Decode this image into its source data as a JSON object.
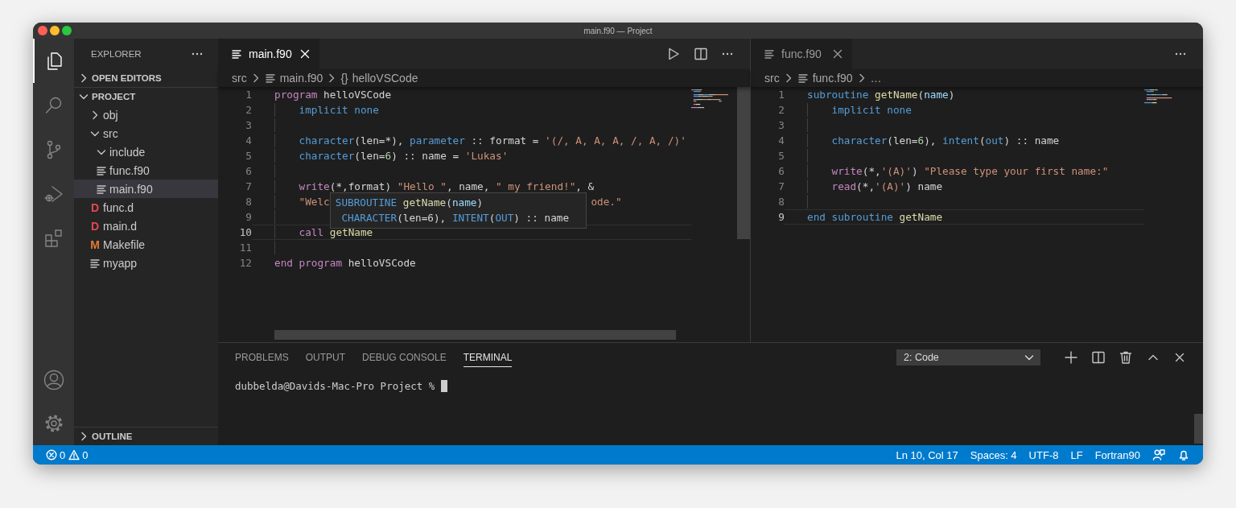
{
  "window": {
    "title": "main.f90 — Project"
  },
  "activity_bar": [
    {
      "kind": "files",
      "selected": true
    },
    {
      "kind": "search",
      "selected": false
    },
    {
      "kind": "source-control",
      "selected": false
    },
    {
      "kind": "run-debug",
      "selected": false
    },
    {
      "kind": "extensions",
      "selected": false
    }
  ],
  "activity_bar_bottom": [
    {
      "kind": "account"
    },
    {
      "kind": "settings"
    }
  ],
  "sidebar": {
    "title": "EXPLORER",
    "sections": [
      {
        "title": "OPEN EDITORS",
        "expanded": false
      },
      {
        "title": "PROJECT",
        "expanded": true,
        "items": [
          {
            "label": "obj",
            "kind": "folder",
            "expanded": false,
            "selected": false
          },
          {
            "label": "src",
            "kind": "folder",
            "expanded": true,
            "selected": false,
            "children": [
              {
                "label": "include",
                "kind": "folder",
                "expanded": true,
                "selected": false
              },
              {
                "label": "func.f90",
                "kind": "file",
                "selected": false
              },
              {
                "label": "main.f90",
                "kind": "file",
                "selected": true
              }
            ]
          },
          {
            "label": "func.d",
            "kind": "letter-file",
            "letter": "D",
            "color": "#e0484e",
            "selected": false
          },
          {
            "label": "main.d",
            "kind": "letter-file",
            "letter": "D",
            "color": "#e0484e",
            "selected": false
          },
          {
            "label": "Makefile",
            "kind": "letter-file",
            "letter": "M",
            "color": "#e37933",
            "selected": false
          },
          {
            "label": "myapp",
            "kind": "file",
            "selected": false
          }
        ]
      },
      {
        "title": "OUTLINE",
        "expanded": false
      }
    ]
  },
  "editor_groups": [
    {
      "focused": true,
      "tabs": [
        {
          "label": "main.f90",
          "selected": true
        }
      ],
      "actions": [
        {
          "kind": "run"
        },
        {
          "kind": "split"
        },
        {
          "kind": "more"
        }
      ],
      "breadcrumb": [
        {
          "kind": "text",
          "text": "src"
        },
        {
          "kind": "file",
          "text": "main.f90"
        },
        {
          "kind": "symbol",
          "icon": "{}",
          "text": "helloVSCode"
        }
      ],
      "lines": [
        {
          "number": "1",
          "current": false,
          "indented": false,
          "tokens": [
            {
              "kind": "keyword",
              "text": "program"
            },
            {
              "kind": "plain",
              "text": " helloVSCode"
            }
          ]
        },
        {
          "number": "2",
          "current": false,
          "indented": true,
          "tokens": [
            {
              "kind": "type",
              "text": "implicit none"
            }
          ]
        },
        {
          "number": "3",
          "current": false,
          "indented": true
        },
        {
          "number": "4",
          "current": false,
          "indented": true,
          "tokens": [
            {
              "kind": "type",
              "text": "character"
            },
            {
              "kind": "plain",
              "text": "(len=*), "
            },
            {
              "kind": "type",
              "text": "parameter"
            },
            {
              "kind": "plain",
              "text": " :: format = "
            },
            {
              "kind": "string",
              "text": "'(/, A, A, A, /, A, /)'"
            }
          ]
        },
        {
          "number": "5",
          "current": false,
          "indented": true,
          "tokens": [
            {
              "kind": "type",
              "text": "character"
            },
            {
              "kind": "plain",
              "text": "(len="
            },
            {
              "kind": "number",
              "text": "6"
            },
            {
              "kind": "plain",
              "text": ") :: name = "
            },
            {
              "kind": "string",
              "text": "'Lukas'"
            }
          ]
        },
        {
          "number": "6",
          "current": false,
          "indented": true
        },
        {
          "number": "7",
          "current": false,
          "indented": true,
          "tokens": [
            {
              "kind": "keyword",
              "text": "write"
            },
            {
              "kind": "plain",
              "text": "(*,format) "
            },
            {
              "kind": "string",
              "text": "\"Hello \""
            },
            {
              "kind": "plain",
              "text": ", name, "
            },
            {
              "kind": "string",
              "text": "\" my friend!\""
            },
            {
              "kind": "plain",
              "text": ", &"
            }
          ]
        },
        {
          "number": "8",
          "current": false,
          "indented": true,
          "tokens": [
            {
              "kind": "string",
              "text": "\"Welc"
            },
            {
              "kind": "hidden"
            },
            {
              "kind": "string",
              "text": "ode.\""
            }
          ]
        },
        {
          "number": "9",
          "current": false,
          "indented": true
        },
        {
          "number": "10",
          "current": true,
          "indented": true,
          "tokens": [
            {
              "kind": "keyword",
              "text": "call"
            },
            {
              "kind": "function",
              "text": " getName"
            }
          ]
        },
        {
          "number": "11",
          "current": false,
          "indented": true
        },
        {
          "number": "12",
          "current": false,
          "indented": false,
          "tokens": [
            {
              "kind": "keyword",
              "text": "end program"
            },
            {
              "kind": "plain",
              "text": " helloVSCode"
            }
          ]
        }
      ],
      "hover": {
        "lines": [
          [
            {
              "kind": "type",
              "text": "SUBROUTINE"
            },
            {
              "kind": "function",
              "text": " getName"
            },
            {
              "kind": "plain",
              "text": "("
            },
            {
              "kind": "variable",
              "text": "name"
            },
            {
              "kind": "plain",
              "text": ")"
            }
          ],
          [
            {
              "kind": "type",
              "text": " CHARACTER"
            },
            {
              "kind": "plain",
              "text": "(len=6), "
            },
            {
              "kind": "type",
              "text": "INTENT"
            },
            {
              "kind": "plain",
              "text": "("
            },
            {
              "kind": "type",
              "text": "OUT"
            },
            {
              "kind": "plain",
              "text": ") :: name"
            }
          ]
        ]
      }
    },
    {
      "focused": false,
      "tabs": [
        {
          "label": "func.f90",
          "selected": true
        }
      ],
      "actions": [
        {
          "kind": "more"
        }
      ],
      "breadcrumb": [
        {
          "kind": "text",
          "text": "src"
        },
        {
          "kind": "file",
          "text": "func.f90"
        },
        {
          "kind": "text",
          "text": "…"
        }
      ],
      "lines": [
        {
          "number": "1",
          "current": false,
          "indented": false,
          "tokens": [
            {
              "kind": "type",
              "text": "subroutine"
            },
            {
              "kind": "function",
              "text": " getName"
            },
            {
              "kind": "plain",
              "text": "("
            },
            {
              "kind": "variable",
              "text": "name"
            },
            {
              "kind": "plain",
              "text": ")"
            }
          ]
        },
        {
          "number": "2",
          "current": false,
          "indented": true,
          "tokens": [
            {
              "kind": "type",
              "text": "implicit none"
            }
          ]
        },
        {
          "number": "3",
          "current": false,
          "indented": true
        },
        {
          "number": "4",
          "current": false,
          "indented": true,
          "tokens": [
            {
              "kind": "type",
              "text": "character"
            },
            {
              "kind": "plain",
              "text": "(len="
            },
            {
              "kind": "number",
              "text": "6"
            },
            {
              "kind": "plain",
              "text": "), "
            },
            {
              "kind": "type",
              "text": "intent"
            },
            {
              "kind": "plain",
              "text": "("
            },
            {
              "kind": "type",
              "text": "out"
            },
            {
              "kind": "plain",
              "text": ") :: name"
            }
          ]
        },
        {
          "number": "5",
          "current": false,
          "indented": true
        },
        {
          "number": "6",
          "current": false,
          "indented": true,
          "tokens": [
            {
              "kind": "keyword",
              "text": "write"
            },
            {
              "kind": "plain",
              "text": "(*,"
            },
            {
              "kind": "string",
              "text": "'(A)'"
            },
            {
              "kind": "plain",
              "text": ") "
            },
            {
              "kind": "string",
              "text": "\"Please type your first name:\""
            }
          ]
        },
        {
          "number": "7",
          "current": false,
          "indented": true,
          "tokens": [
            {
              "kind": "keyword",
              "text": "read"
            },
            {
              "kind": "plain",
              "text": "(*,"
            },
            {
              "kind": "string",
              "text": "'(A)'"
            },
            {
              "kind": "plain",
              "text": ") name"
            }
          ]
        },
        {
          "number": "8",
          "current": false,
          "indented": true
        },
        {
          "number": "9",
          "current": true,
          "indented": false,
          "tokens": [
            {
              "kind": "type",
              "text": "end subroutine"
            },
            {
              "kind": "function",
              "text": " getName"
            }
          ]
        }
      ]
    }
  ],
  "panel": {
    "tabs": [
      {
        "label": "PROBLEMS",
        "selected": false
      },
      {
        "label": "OUTPUT",
        "selected": false
      },
      {
        "label": "DEBUG CONSOLE",
        "selected": false
      },
      {
        "label": "TERMINAL",
        "selected": true
      }
    ],
    "terminal_select": {
      "value": "2: Code"
    },
    "actions": [
      {
        "kind": "add"
      },
      {
        "kind": "split"
      },
      {
        "kind": "trash"
      },
      {
        "kind": "maximize"
      },
      {
        "kind": "close"
      }
    ],
    "terminal": {
      "prompt": "dubbelda@Davids-Mac-Pro Project %"
    }
  },
  "status_bar": {
    "left": [
      {
        "kind": "errors",
        "text": "0"
      },
      {
        "kind": "warnings",
        "text": "0"
      }
    ],
    "right": [
      {
        "kind": "text",
        "text": "Ln 10, Col 17"
      },
      {
        "kind": "text",
        "text": "Spaces: 4"
      },
      {
        "kind": "text",
        "text": "UTF-8"
      },
      {
        "kind": "text",
        "text": "LF"
      },
      {
        "kind": "text",
        "text": "Fortran90"
      },
      {
        "kind": "feedback"
      },
      {
        "kind": "bell"
      }
    ]
  }
}
